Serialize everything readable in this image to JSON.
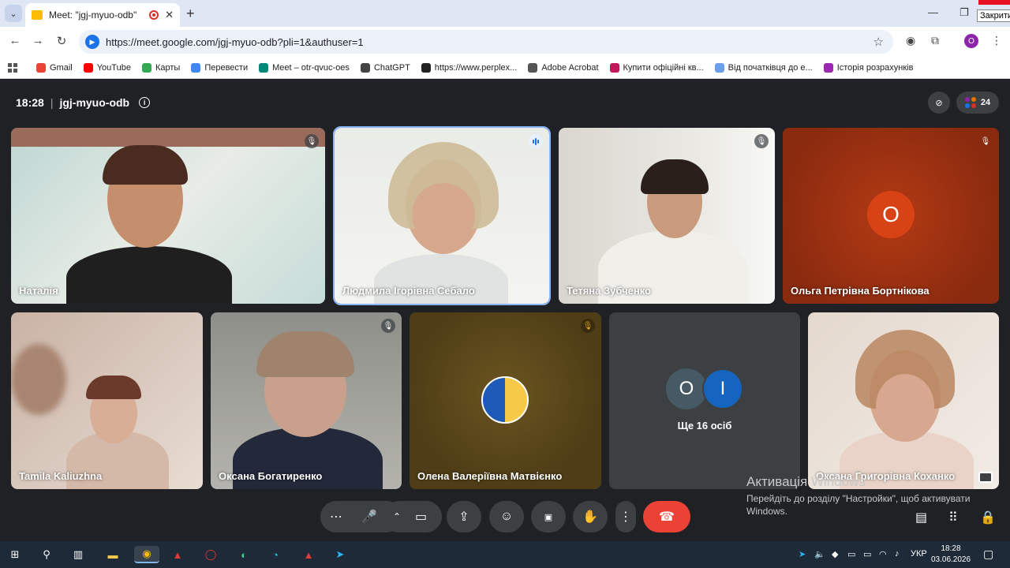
{
  "browser": {
    "tab_title": "Meet: \"jgj-myuo-odb\"",
    "close_tooltip": "Закрити",
    "url": "https://meet.google.com/jgj-myuo-odb?pli=1&authuser=1",
    "profile_letter": "O"
  },
  "bookmarks": [
    {
      "label": "Gmail",
      "color": "#ea4335"
    },
    {
      "label": "YouTube",
      "color": "#ff0000"
    },
    {
      "label": "Карты",
      "color": "#34a853"
    },
    {
      "label": "Перевести",
      "color": "#4285f4"
    },
    {
      "label": "Meet – otr-qvuc-oes",
      "color": "#00897b"
    },
    {
      "label": "ChatGPT",
      "color": "#444444"
    },
    {
      "label": "https://www.perplex...",
      "color": "#222222"
    },
    {
      "label": "Adobe Acrobat",
      "color": "#555555"
    },
    {
      "label": "Купити офіційні кв...",
      "color": "#c2185b"
    },
    {
      "label": "Від початківця до е...",
      "color": "#6d9eeb"
    },
    {
      "label": "Історія розрахунків",
      "color": "#9c27b0"
    }
  ],
  "meet": {
    "time": "18:28",
    "separator": "|",
    "meeting_code": "jgj-myuo-odb",
    "people_count": "24",
    "participants": [
      {
        "name": "Наталія"
      },
      {
        "name": "Людмила Ігорівна Себало"
      },
      {
        "name": "Тетяна Зубченко"
      },
      {
        "name": "Ольга Петрівна Бортнікова",
        "avatar_letter": "О"
      },
      {
        "name": "Tamila Kaliuzhna"
      },
      {
        "name": "Оксана Богатиренко"
      },
      {
        "name": "Олена Валеріївна Матвієнко"
      },
      {
        "name": "Оксана Григорівна Коханко"
      }
    ],
    "others": {
      "label": "Ще 16 осіб",
      "avatar_letters": [
        "О",
        "І"
      ]
    }
  },
  "watermark": {
    "title": "Активація Windows",
    "text": "Перейдіть до розділу \"Настройки\", щоб активувати Windows."
  },
  "taskbar": {
    "language": "УКР",
    "time": "18:28",
    "date": "03.06.2026"
  }
}
